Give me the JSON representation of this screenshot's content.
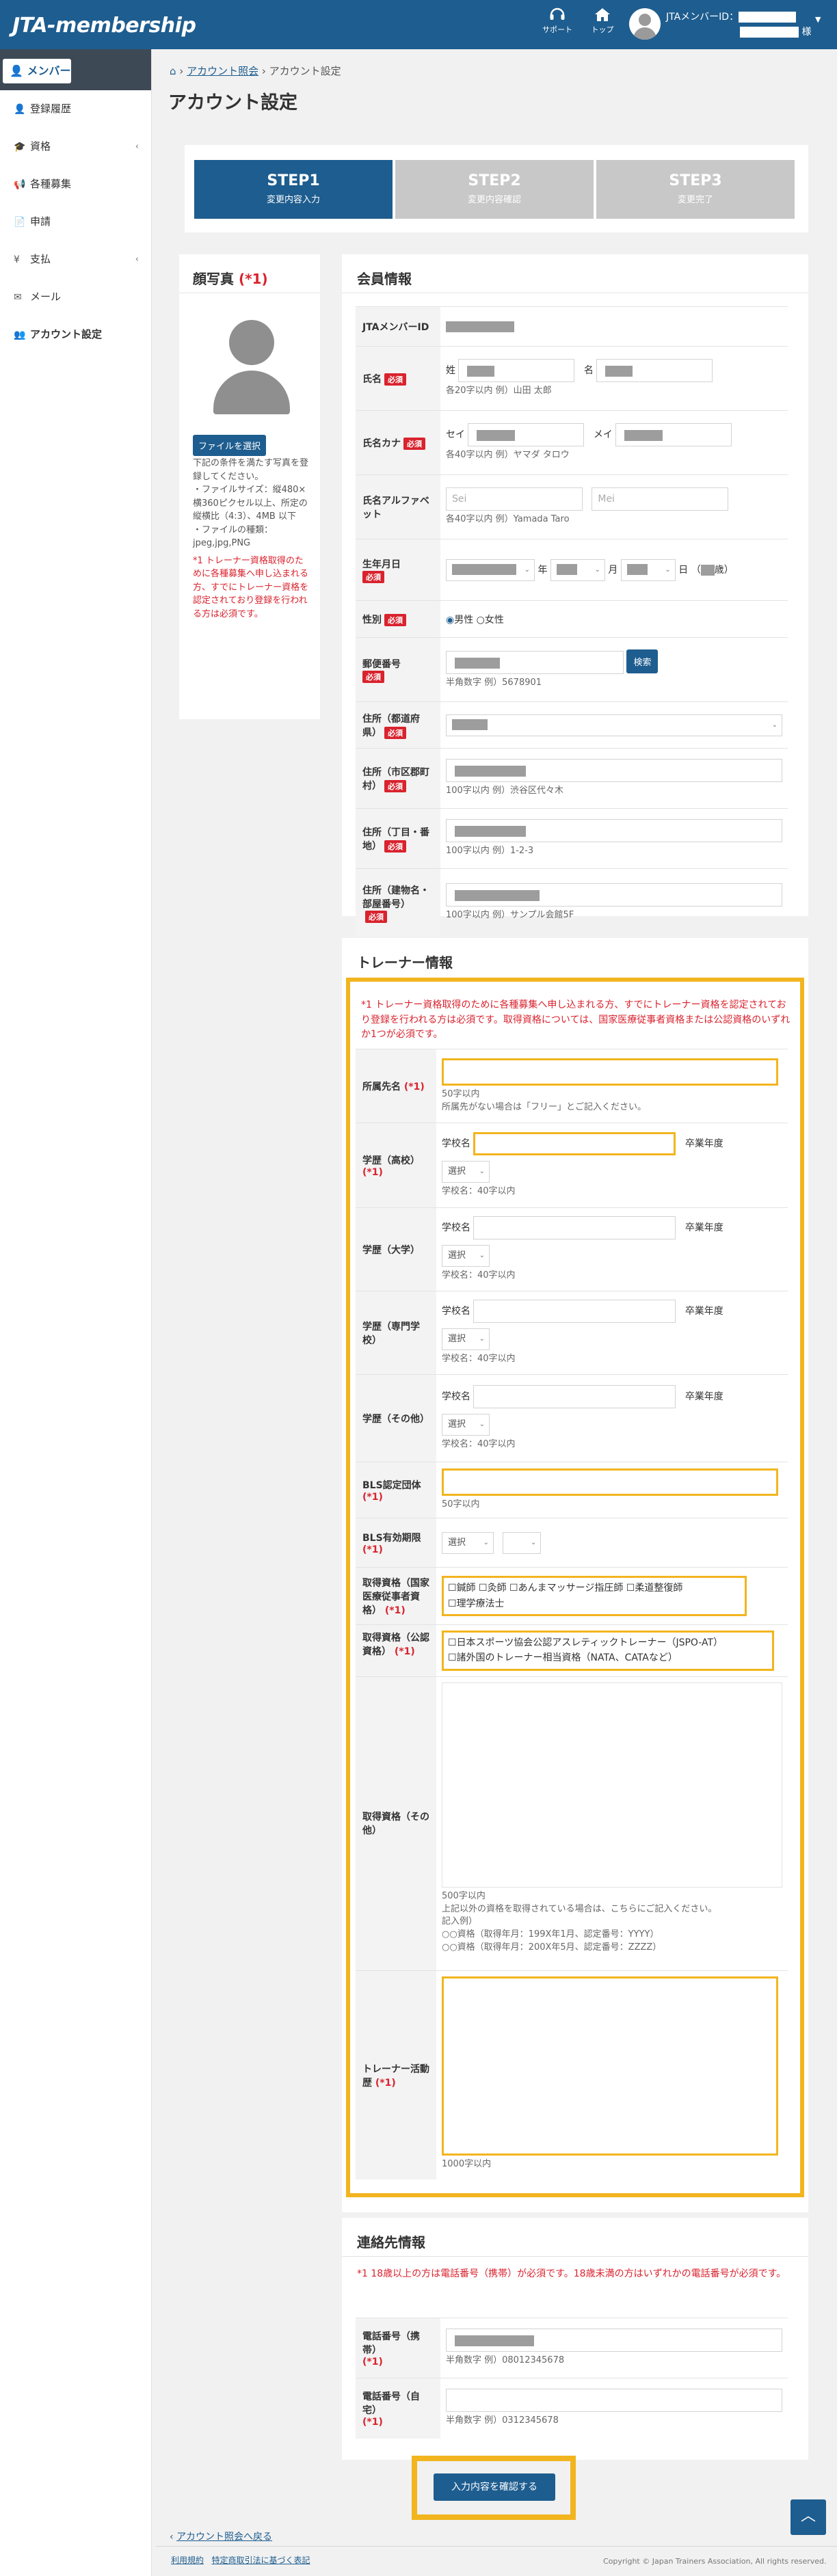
{
  "header": {
    "logo": "JTA-membership",
    "support_label": "サポート",
    "top_label": "トップ",
    "member_id_label": "JTAメンバーID：",
    "honorific": "様"
  },
  "sidebar": {
    "items": [
      {
        "label": "メンバー",
        "icon": "user-icon"
      },
      {
        "label": "登録履歴",
        "icon": "user-icon"
      },
      {
        "label": "資格",
        "icon": "graduation-icon"
      },
      {
        "label": "各種募集",
        "icon": "bullhorn-icon"
      },
      {
        "label": "申請",
        "icon": "file-icon"
      },
      {
        "label": "支払",
        "icon": "yen-icon"
      },
      {
        "label": "メール",
        "icon": "envelope-icon"
      },
      {
        "label": "アカウント設定",
        "icon": "user-gear-icon"
      }
    ]
  },
  "breadcrumb": {
    "parent": "アカウント照会",
    "current": "アカウント設定"
  },
  "page_title": "アカウント設定",
  "steps": [
    {
      "title": "STEP1",
      "sub": "変更内容入力"
    },
    {
      "title": "STEP2",
      "sub": "変更内容確認"
    },
    {
      "title": "STEP3",
      "sub": "変更完了"
    }
  ],
  "photo": {
    "title": "顔写真",
    "req_mark": "(*1)",
    "file_button": "ファイルを選択",
    "desc1": "下記の条件を満たす写真を登録してください。",
    "desc2": "・ファイルサイズ：縦480×横360ピクセル以上、所定の縦横比（4:3）、4MB 以下",
    "desc3": "・ファイルの種類：jpeg,jpg,PNG",
    "note": "*1 トレーナー資格取得のために各種募集へ申し込まれる方、すでにトレーナー資格を認定されており登録を行われる方は必須です。"
  },
  "member": {
    "title": "会員情報",
    "required_badge": "必須",
    "id_label": "JTAメンバーID",
    "name_label": "氏名",
    "sei": "姓",
    "mei": "名",
    "name_hint": "各20字以内 例）山田 太郎",
    "kana_label": "氏名カナ",
    "kana_sei": "セイ",
    "kana_mei": "メイ",
    "kana_hint": "各40字以内 例）ヤマダ タロウ",
    "alpha_label": "氏名アルファベット",
    "alpha_sei_ph": "Sei",
    "alpha_mei_ph": "Mei",
    "alpha_hint": "各40字以内 例）Yamada Taro",
    "birth_label": "生年月日",
    "year": "年",
    "month": "月",
    "day": "日",
    "age_open": "（",
    "age_close": "歳）",
    "gender_label": "性別",
    "male": "男性",
    "female": "女性",
    "postal_label": "郵便番号",
    "search_button": "検索",
    "postal_hint": "半角数字 例）5678901",
    "pref_label": "住所（都道府県）",
    "city_label": "住所（市区郡町村）",
    "city_hint": "100字以内 例）渋谷区代々木",
    "street_label": "住所（丁目・番地）",
    "street_hint": "100字以内 例）1-2-3",
    "bldg_label": "住所（建物名・部屋番号）",
    "bldg_hint": "100字以内 例）サンプル会館5F"
  },
  "trainer": {
    "title": "トレーナー情報",
    "note": "*1 トレーナー資格取得のために各種募集へ申し込まれる方、すでにトレーナー資格を認定されており登録を行われる方は必須です。取得資格については、国家医療従事者資格または公認資格のいずれか1つが必須です。",
    "req_mark": "(*1)",
    "affil_label": "所属先名",
    "affil_hint1": "50字以内",
    "affil_hint2": "所属先がない場合は「フリー」とご記入ください。",
    "school_label": "学校名",
    "grad_label": "卒業年度",
    "select_ph": "選択",
    "school_hint": "学校名：40字以内",
    "hs_label": "学歴（高校）",
    "univ_label": "学歴（大学）",
    "voc_label": "学歴（専門学校）",
    "other_edu_label": "学歴（その他）",
    "bls_org_label": "BLS認定団体",
    "bls_org_hint": "50字以内",
    "bls_exp_label": "BLS有効期限",
    "national_label": "取得資格（国家医療従事者資格）",
    "national_opts": [
      "鍼師",
      "灸師",
      "あんまマッサージ指圧師",
      "柔道整復師",
      "理学療法士"
    ],
    "official_label": "取得資格（公認資格）",
    "official_opts": [
      "日本スポーツ協会公認アスレティックトレーナー（JSPO-AT）",
      "諸外国のトレーナー相当資格（NATA、CATAなど）"
    ],
    "other_qual_label": "取得資格（その他）",
    "other_hint1": "500字以内",
    "other_hint2": "上記以外の資格を取得されている場合は、こちらにご記入ください。",
    "other_hint3": "記入例）",
    "other_hint4": "○○資格（取得年月：199X年1月、認定番号：YYYY）",
    "other_hint5": "○○資格（取得年月：200X年5月、認定番号：ZZZZ）",
    "career_label": "トレーナー活動歴",
    "career_hint": "1000字以内"
  },
  "contact": {
    "title": "連絡先情報",
    "note": "*1 18歳以上の方は電話番号（携帯）が必須です。18歳未満の方はいずれかの電話番号が必須です。",
    "mobile_label": "電話番号（携帯）",
    "mobile_hint": "半角数字 例）08012345678",
    "home_label": "電話番号（自宅）",
    "home_hint": "半角数字 例）0312345678"
  },
  "confirm_button": "入力内容を確認する",
  "footer": {
    "back_link": "アカウント照会へ戻る",
    "terms": "利用規約",
    "law": "特定商取引法に基づく表記",
    "copyright": "Copyright © Japan Trainers Association, All rights reserved."
  },
  "colors": {
    "primary": "#1e5d8f",
    "required": "#d9232e",
    "highlight": "#f2b51f"
  }
}
